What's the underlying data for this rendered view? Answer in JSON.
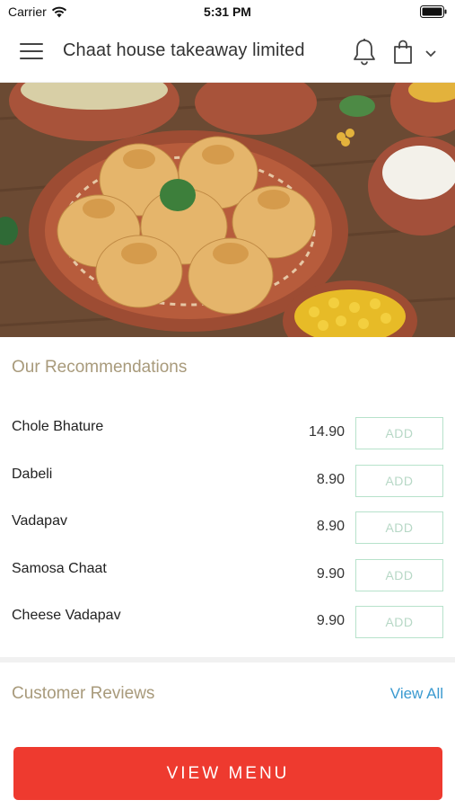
{
  "status_bar": {
    "carrier": "Carrier",
    "time": "5:31 PM"
  },
  "header": {
    "title": "Chaat house takeaway limited",
    "icons": [
      "menu-icon",
      "bell-icon",
      "shopping-bag-icon",
      "chevron-down-icon"
    ]
  },
  "hero": {
    "icon": "food-photo"
  },
  "recommendations": {
    "title": "Our Recommendations",
    "items": [
      {
        "name": "Chole Bhature",
        "price": "14.90",
        "add_label": "ADD"
      },
      {
        "name": "Dabeli",
        "price": "8.90",
        "add_label": "ADD"
      },
      {
        "name": "Vadapav",
        "price": "8.90",
        "add_label": "ADD"
      },
      {
        "name": "Samosa Chaat",
        "price": "9.90",
        "add_label": "ADD"
      },
      {
        "name": "Cheese Vadapav",
        "price": "9.90",
        "add_label": "ADD"
      }
    ]
  },
  "reviews": {
    "title": "Customer Reviews",
    "view_all_label": "View All"
  },
  "cta": {
    "label": "VIEW MENU"
  },
  "colors": {
    "accent_red": "#ee3a2f",
    "section_title": "#a89a7b",
    "add_border": "#b7e2cb",
    "link_blue": "#3a9ad0"
  }
}
